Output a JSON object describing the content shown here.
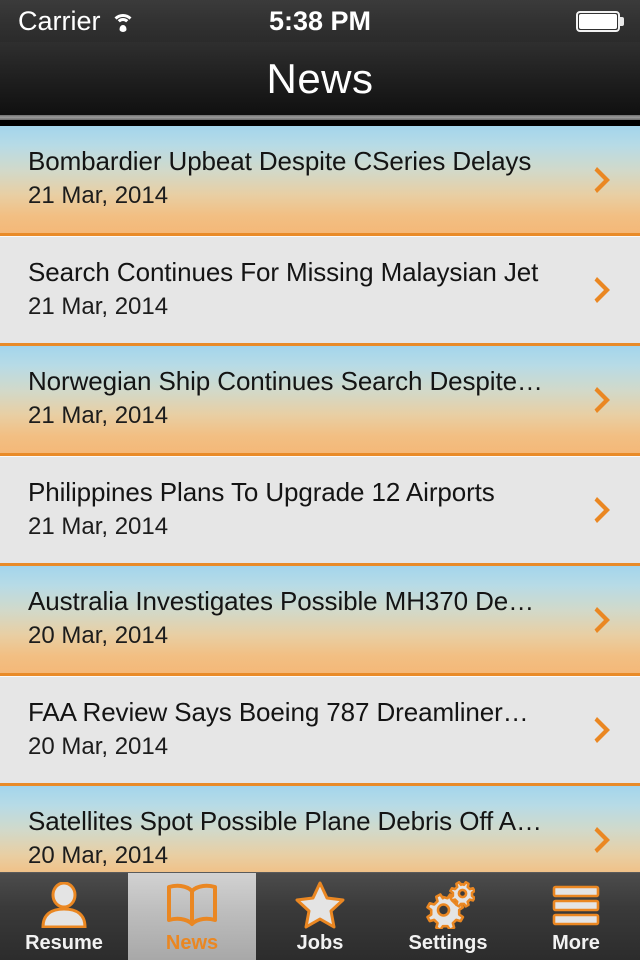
{
  "status_bar": {
    "carrier": "Carrier",
    "wifi_icon": "wifi-icon",
    "time": "5:38 PM",
    "battery_icon": "battery-full-icon"
  },
  "navbar": {
    "title": "News"
  },
  "list": {
    "rows": [
      {
        "title": "Bombardier Upbeat Despite CSeries Delays",
        "date": "21 Mar, 2014",
        "style": "grad",
        "chevron": "chevron-right-icon"
      },
      {
        "title": "Search Continues For Missing Malaysian Jet",
        "date": "21 Mar, 2014",
        "style": "plain",
        "chevron": "chevron-right-icon"
      },
      {
        "title": "Norwegian Ship Continues Search Despite…",
        "date": "21 Mar, 2014",
        "style": "grad",
        "chevron": "chevron-right-icon"
      },
      {
        "title": "Philippines Plans To Upgrade 12 Airports",
        "date": "21 Mar, 2014",
        "style": "plain",
        "chevron": "chevron-right-icon"
      },
      {
        "title": "Australia Investigates Possible MH370 De…",
        "date": "20 Mar, 2014",
        "style": "grad",
        "chevron": "chevron-right-icon"
      },
      {
        "title": "FAA Review Says Boeing 787 Dreamliner…",
        "date": "20 Mar, 2014",
        "style": "plain",
        "chevron": "chevron-right-icon"
      },
      {
        "title": "Satellites Spot Possible Plane Debris Off A…",
        "date": "20 Mar, 2014",
        "style": "grad",
        "chevron": "chevron-right-icon"
      }
    ]
  },
  "tabbar": {
    "tabs": [
      {
        "label": "Resume",
        "icon": "person-icon",
        "active": false
      },
      {
        "label": "News",
        "icon": "book-icon",
        "active": true
      },
      {
        "label": "Jobs",
        "icon": "star-icon",
        "active": false
      },
      {
        "label": "Settings",
        "icon": "gears-icon",
        "active": false
      },
      {
        "label": "More",
        "icon": "hamburger-icon",
        "active": false
      }
    ]
  },
  "colors": {
    "accent_orange": "#ea8722",
    "row_gradient_top": "#a3d5ec",
    "row_gradient_bottom": "#f4b878",
    "row_plain_bg": "#e6e6e6",
    "tabbar_bg": "#3a3a3a",
    "navbar_bg": "#1f1f1f"
  }
}
